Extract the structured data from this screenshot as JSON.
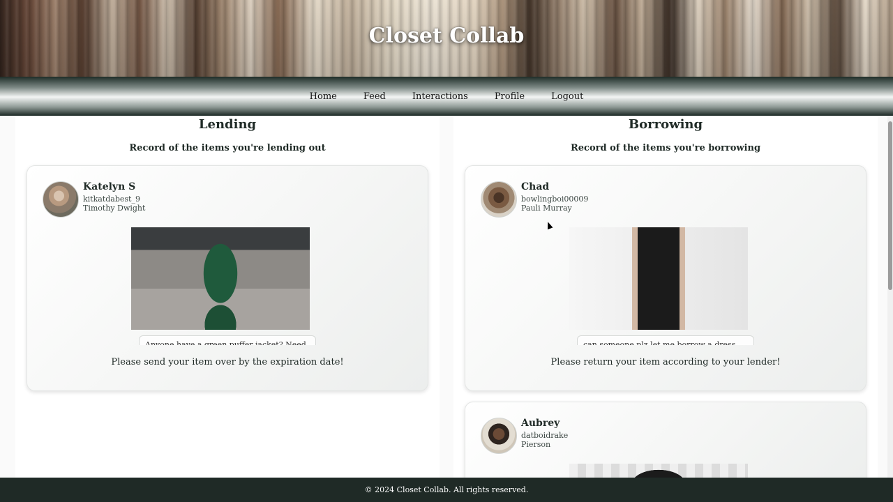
{
  "header": {
    "site_title": "Closet Collab"
  },
  "nav": {
    "items": [
      "Home",
      "Feed",
      "Interactions",
      "Profile",
      "Logout"
    ]
  },
  "lending": {
    "title": "Lending",
    "subtitle": "Record of the items you're lending out",
    "cards": [
      {
        "name": "Katelyn S",
        "handle": "kitkatdabest_9",
        "college": "Timothy Dwight",
        "description": "Anyone have a green puffer jacket? Need",
        "note": "Please send your item over by the expiration date!"
      }
    ]
  },
  "borrowing": {
    "title": "Borrowing",
    "subtitle": "Record of the items you're borrowing",
    "cards": [
      {
        "name": "Chad",
        "handle": "bowlingboi00009",
        "college": "Pauli Murray",
        "description": "can someone plz let me borrow a dress",
        "note": "Please return your item according to your lender!"
      },
      {
        "name": "Aubrey",
        "handle": "datboidrake",
        "college": "Pierson"
      }
    ]
  },
  "footer": {
    "text": "© 2024 Closet Collab. All rights reserved."
  }
}
